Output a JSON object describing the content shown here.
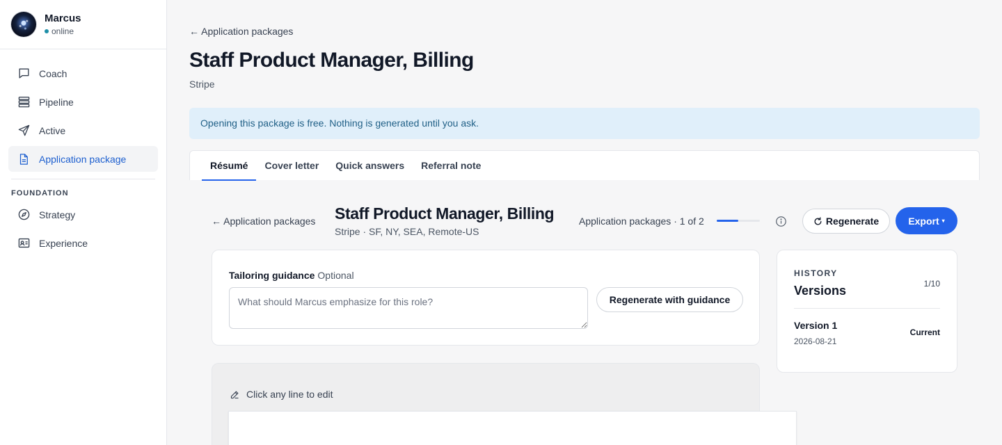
{
  "user": {
    "name": "Marcus",
    "status": "online",
    "status_color": "#1e8fa8"
  },
  "sidebar": {
    "items": [
      {
        "label": "Coach",
        "icon": "chat-bubble-icon"
      },
      {
        "label": "Pipeline",
        "icon": "stack-icon"
      },
      {
        "label": "Active",
        "icon": "send-icon"
      },
      {
        "label": "Application package",
        "icon": "document-icon",
        "active": true
      }
    ],
    "section_label": "FOUNDATION",
    "section_items": [
      {
        "label": "Strategy",
        "icon": "compass-icon"
      },
      {
        "label": "Experience",
        "icon": "id-card-icon"
      }
    ]
  },
  "header": {
    "back_label": "← Application packages",
    "title": "Staff Product Manager, Billing",
    "subtitle": "Stripe"
  },
  "notice": {
    "text": "Opening this package is free. Nothing is generated until you ask."
  },
  "tabs": [
    {
      "label": "Résumé",
      "active": true
    },
    {
      "label": "Cover letter"
    },
    {
      "label": "Quick answers"
    },
    {
      "label": "Referral note"
    }
  ],
  "package": {
    "back_label": "← Application packages",
    "title": "Staff Product Manager, Billing",
    "subtitle": "Stripe · SF, NY, SEA, Remote-US",
    "pager_label": "Application packages · 1 of 2",
    "pager_progress": 0.5,
    "regenerate_label": "Regenerate",
    "export_label": "Export",
    "export_caret": "▾"
  },
  "guidance": {
    "label": "Tailoring guidance",
    "optional": "Optional",
    "placeholder": "What should Marcus emphasize for this role?",
    "button_label": "Regenerate with guidance"
  },
  "history": {
    "eyebrow": "HISTORY",
    "title": "Versions",
    "count": "1/10",
    "versions": [
      {
        "name": "Version 1",
        "date": "2026-08-21",
        "badge": "Current"
      }
    ]
  },
  "editor": {
    "hint": "Click any line to edit"
  },
  "colors": {
    "accent": "#2463eb",
    "active_nav": "#1d5fcf",
    "notice_bg": "#e0effa"
  }
}
